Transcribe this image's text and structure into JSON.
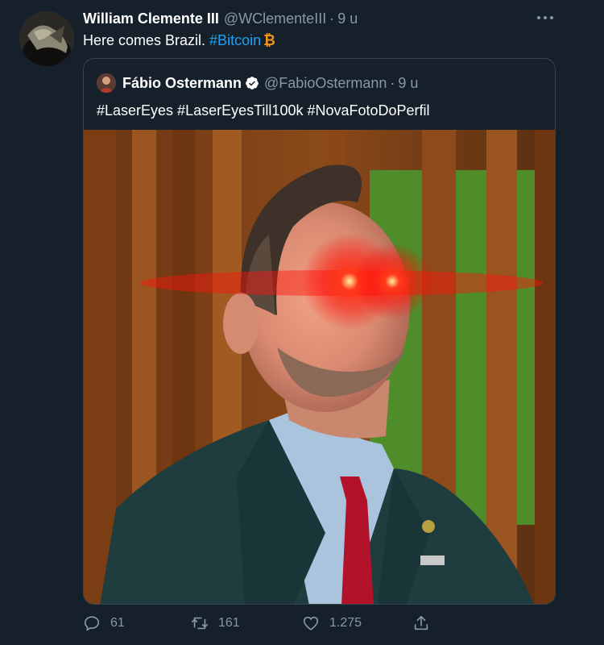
{
  "tweet": {
    "author_name": "William Clemente III",
    "author_handle": "@WClementeIII",
    "separator": "·",
    "time": "9 u",
    "text": "Here comes Brazil.",
    "hashtag": "#Bitcoin",
    "emoji_icon": "bitcoin-icon",
    "emoji_glyph": "₿"
  },
  "quoted_tweet": {
    "author_name": "Fábio Ostermann",
    "author_handle": "@FabioOstermann",
    "separator": "·",
    "time": "9 u",
    "verified": true,
    "text": "#LaserEyes #LaserEyesTill100k #NovaFotoDoPerfil"
  },
  "actions": {
    "reply_count": "61",
    "retweet_count": "161",
    "like_count": "1.275"
  },
  "colors": {
    "background": "#15202b",
    "accent": "#1da1f2",
    "muted": "#8899a6",
    "border": "#38444d",
    "bitcoin": "#f7931a"
  }
}
